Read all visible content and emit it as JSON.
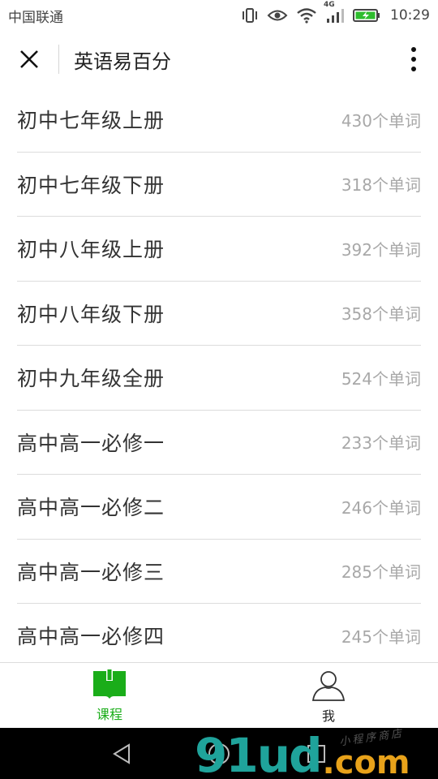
{
  "status_bar": {
    "carrier": "中国联通",
    "network": "4G",
    "time": "10:29"
  },
  "header": {
    "title": "英语易百分"
  },
  "courses": [
    {
      "name": "初中七年级上册",
      "count": "430个单词"
    },
    {
      "name": "初中七年级下册",
      "count": "318个单词"
    },
    {
      "name": "初中八年级上册",
      "count": "392个单词"
    },
    {
      "name": "初中八年级下册",
      "count": "358个单词"
    },
    {
      "name": "初中九年级全册",
      "count": "524个单词"
    },
    {
      "name": "高中高一必修一",
      "count": "233个单词"
    },
    {
      "name": "高中高一必修二",
      "count": "246个单词"
    },
    {
      "name": "高中高一必修三",
      "count": "285个单词"
    },
    {
      "name": "高中高一必修四",
      "count": "245个单词"
    }
  ],
  "tabs": [
    {
      "label": "课程",
      "icon": "book-icon",
      "active": true
    },
    {
      "label": "我",
      "icon": "user-icon",
      "active": false
    }
  ],
  "watermark": {
    "main": "91ud",
    "suffix": ".com",
    "tagline": "小程序商店"
  },
  "colors": {
    "accent": "#1aad19",
    "watermark_teal": "#1fa39b",
    "watermark_orange": "#e8a21a"
  }
}
